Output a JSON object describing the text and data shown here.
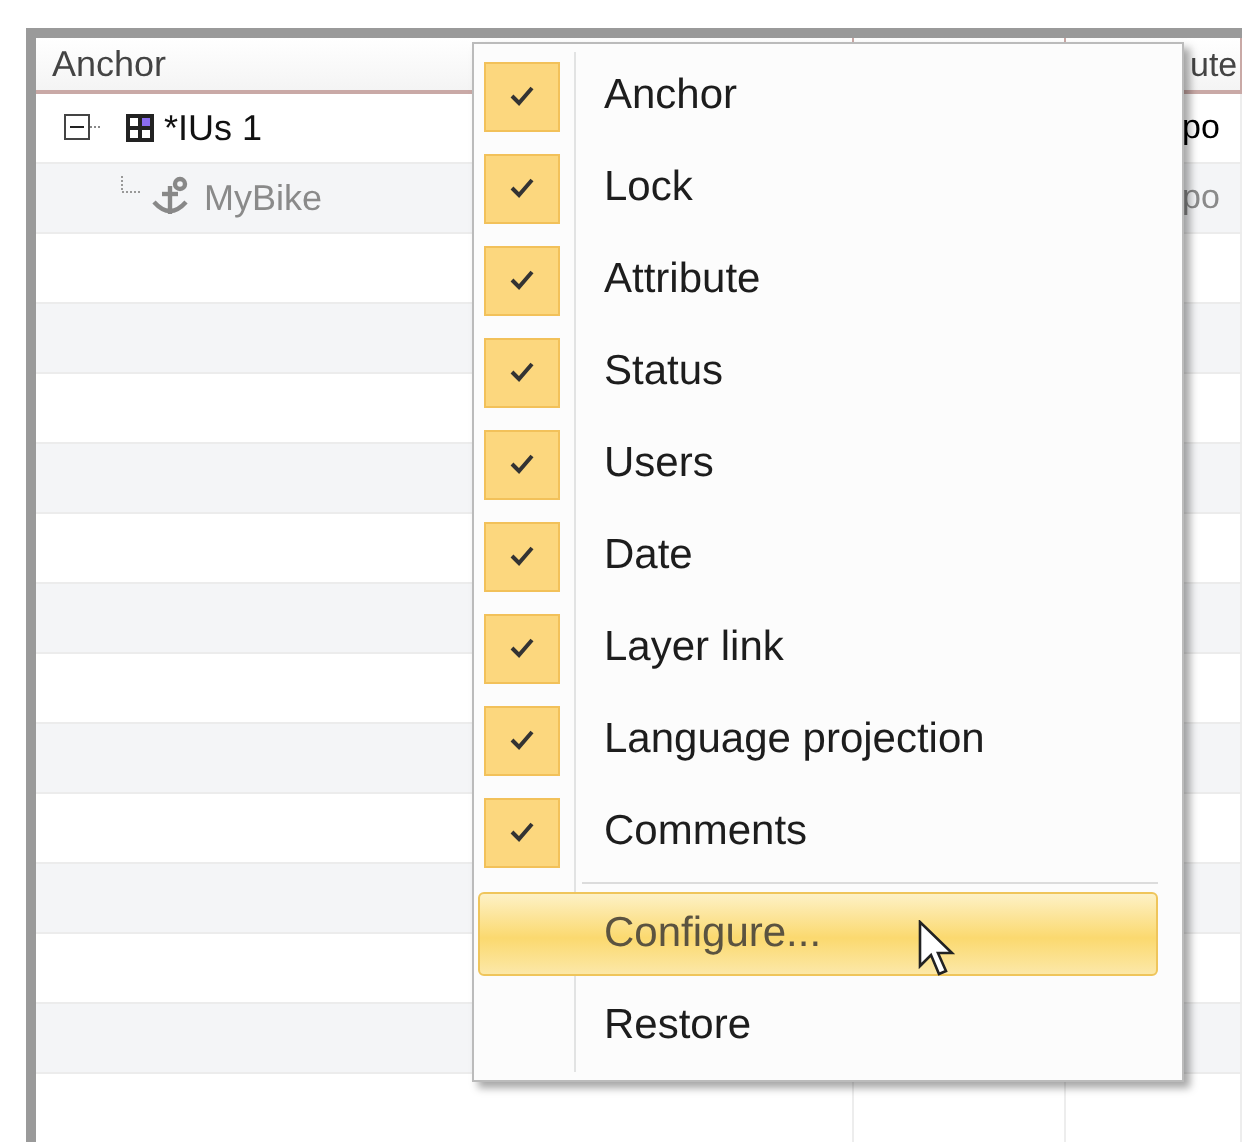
{
  "table": {
    "columns": [
      {
        "label": "Anchor"
      },
      {
        "label": "ute"
      }
    ],
    "tree": [
      {
        "label": "*IUs 1",
        "expanded": true,
        "disabled": false,
        "column_3": "po",
        "children": [
          {
            "label": "MyBike",
            "disabled": true,
            "column_3": "po"
          }
        ]
      }
    ]
  },
  "context_menu": {
    "items": [
      {
        "kind": "check",
        "label": "Anchor",
        "checked": true,
        "selected": false
      },
      {
        "kind": "check",
        "label": "Lock",
        "checked": true,
        "selected": false
      },
      {
        "kind": "check",
        "label": "Attribute",
        "checked": true,
        "selected": false
      },
      {
        "kind": "check",
        "label": "Status",
        "checked": true,
        "selected": false
      },
      {
        "kind": "check",
        "label": "Users",
        "checked": true,
        "selected": false
      },
      {
        "kind": "check",
        "label": "Date",
        "checked": true,
        "selected": false
      },
      {
        "kind": "check",
        "label": "Layer link",
        "checked": true,
        "selected": false
      },
      {
        "kind": "check",
        "label": "Language projection",
        "checked": true,
        "selected": false
      },
      {
        "kind": "check",
        "label": "Comments",
        "checked": true,
        "selected": false
      },
      {
        "kind": "separator"
      },
      {
        "kind": "action",
        "label": "Configure...",
        "selected": true
      },
      {
        "kind": "action",
        "label": "Restore",
        "selected": false
      }
    ]
  }
}
